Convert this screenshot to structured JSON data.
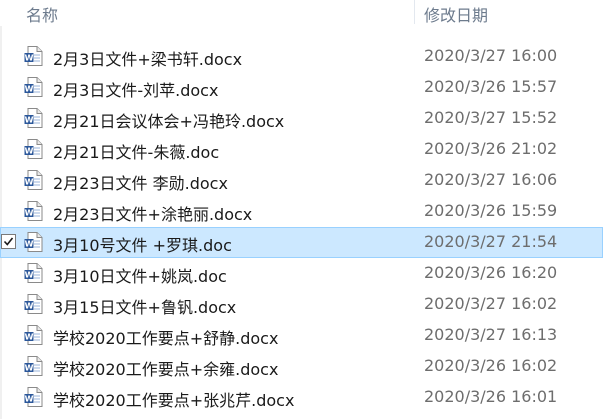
{
  "columns": {
    "name": "名称",
    "modified": "修改日期"
  },
  "files": [
    {
      "name": "2月3日文件+梁书轩.docx",
      "date": "2020/3/27 16:00",
      "selected": false
    },
    {
      "name": "2月3日文件-刘苹.docx",
      "date": "2020/3/26 15:57",
      "selected": false
    },
    {
      "name": "2月21日会议体会+冯艳玲.docx",
      "date": "2020/3/27 15:52",
      "selected": false
    },
    {
      "name": "2月21日文件-朱薇.doc",
      "date": "2020/3/26 21:02",
      "selected": false
    },
    {
      "name": "2月23日文件 李勋.docx",
      "date": "2020/3/27 16:06",
      "selected": false
    },
    {
      "name": "2月23日文件+涂艳丽.docx",
      "date": "2020/3/26 15:59",
      "selected": false
    },
    {
      "name": "3月10号文件 +罗琪.doc",
      "date": "2020/3/27 21:54",
      "selected": true
    },
    {
      "name": "3月10日文件+姚岚.doc",
      "date": "2020/3/26 16:20",
      "selected": false
    },
    {
      "name": "3月15日文件+鲁钒.docx",
      "date": "2020/3/27 16:02",
      "selected": false
    },
    {
      "name": "学校2020工作要点+舒静.docx",
      "date": "2020/3/27 16:13",
      "selected": false
    },
    {
      "name": "学校2020工作要点+余雍.docx",
      "date": "2020/3/26 16:02",
      "selected": false
    },
    {
      "name": "学校2020工作要点+张兆芹.docx",
      "date": "2020/3/26 16:01",
      "selected": false
    }
  ],
  "icons": {
    "file": "word-document-icon",
    "check": "checkbox-checked-icon"
  },
  "colors": {
    "selection_bg": "#cce8ff",
    "selection_border": "#99d1ff",
    "word_blue": "#2b579a"
  }
}
